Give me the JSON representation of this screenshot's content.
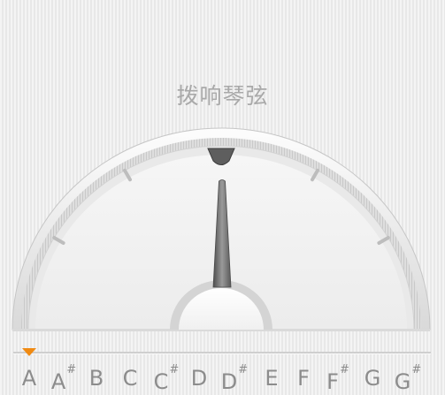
{
  "current_note": "A",
  "status_text": "拨响琴弦",
  "colors": {
    "accent": "#f08a12",
    "note_text": "#8c8c8c",
    "status_text": "#a9a9a9",
    "needle": "#6e6e6e"
  },
  "gauge": {
    "needle_offset": 0,
    "indicator_icon": "triangle-pointer-icon"
  },
  "selected_note_index": 0,
  "notes": [
    {
      "name": "A",
      "sharp": ""
    },
    {
      "name": "A",
      "sharp": "#"
    },
    {
      "name": "B",
      "sharp": ""
    },
    {
      "name": "C",
      "sharp": ""
    },
    {
      "name": "C",
      "sharp": "#"
    },
    {
      "name": "D",
      "sharp": ""
    },
    {
      "name": "D",
      "sharp": "#"
    },
    {
      "name": "E",
      "sharp": ""
    },
    {
      "name": "F",
      "sharp": ""
    },
    {
      "name": "F",
      "sharp": "#"
    },
    {
      "name": "G",
      "sharp": ""
    },
    {
      "name": "G",
      "sharp": "#"
    }
  ]
}
